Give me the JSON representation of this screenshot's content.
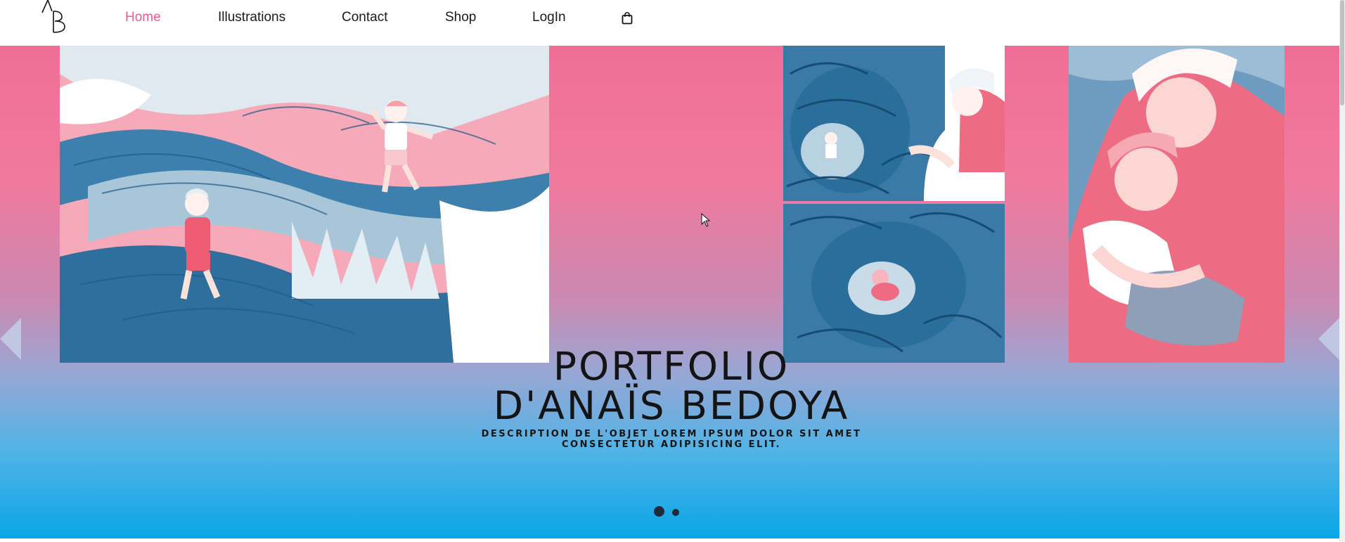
{
  "brand": {
    "logo_text": "AB"
  },
  "nav": {
    "items": [
      {
        "label": "Home",
        "active": true
      },
      {
        "label": "Illustrations",
        "active": false
      },
      {
        "label": "Contact",
        "active": false
      },
      {
        "label": "Shop",
        "active": false
      },
      {
        "label": "LogIn",
        "active": false
      }
    ],
    "cart_icon": "shopping-bag-icon"
  },
  "hero": {
    "title_line1": "PORTFOLIO",
    "title_line2": "D'ANAÏS BEDOYA",
    "description": "DESCRIPTION DE L'OBJET LOREM IPSUM DOLOR SIT AMET CONSECTETUR ADIPISICING ELIT.",
    "prev_icon": "chevron-left-icon",
    "next_icon": "chevron-right-icon",
    "slide_count": 2,
    "active_slide": 1
  },
  "colors": {
    "accent_pink": "#ef5c8c",
    "gradient_top": "#ef6e97",
    "gradient_bottom": "#0aa6e6",
    "illustration_blue": "#2a6e9c",
    "illustration_pink": "#ee6b84"
  }
}
